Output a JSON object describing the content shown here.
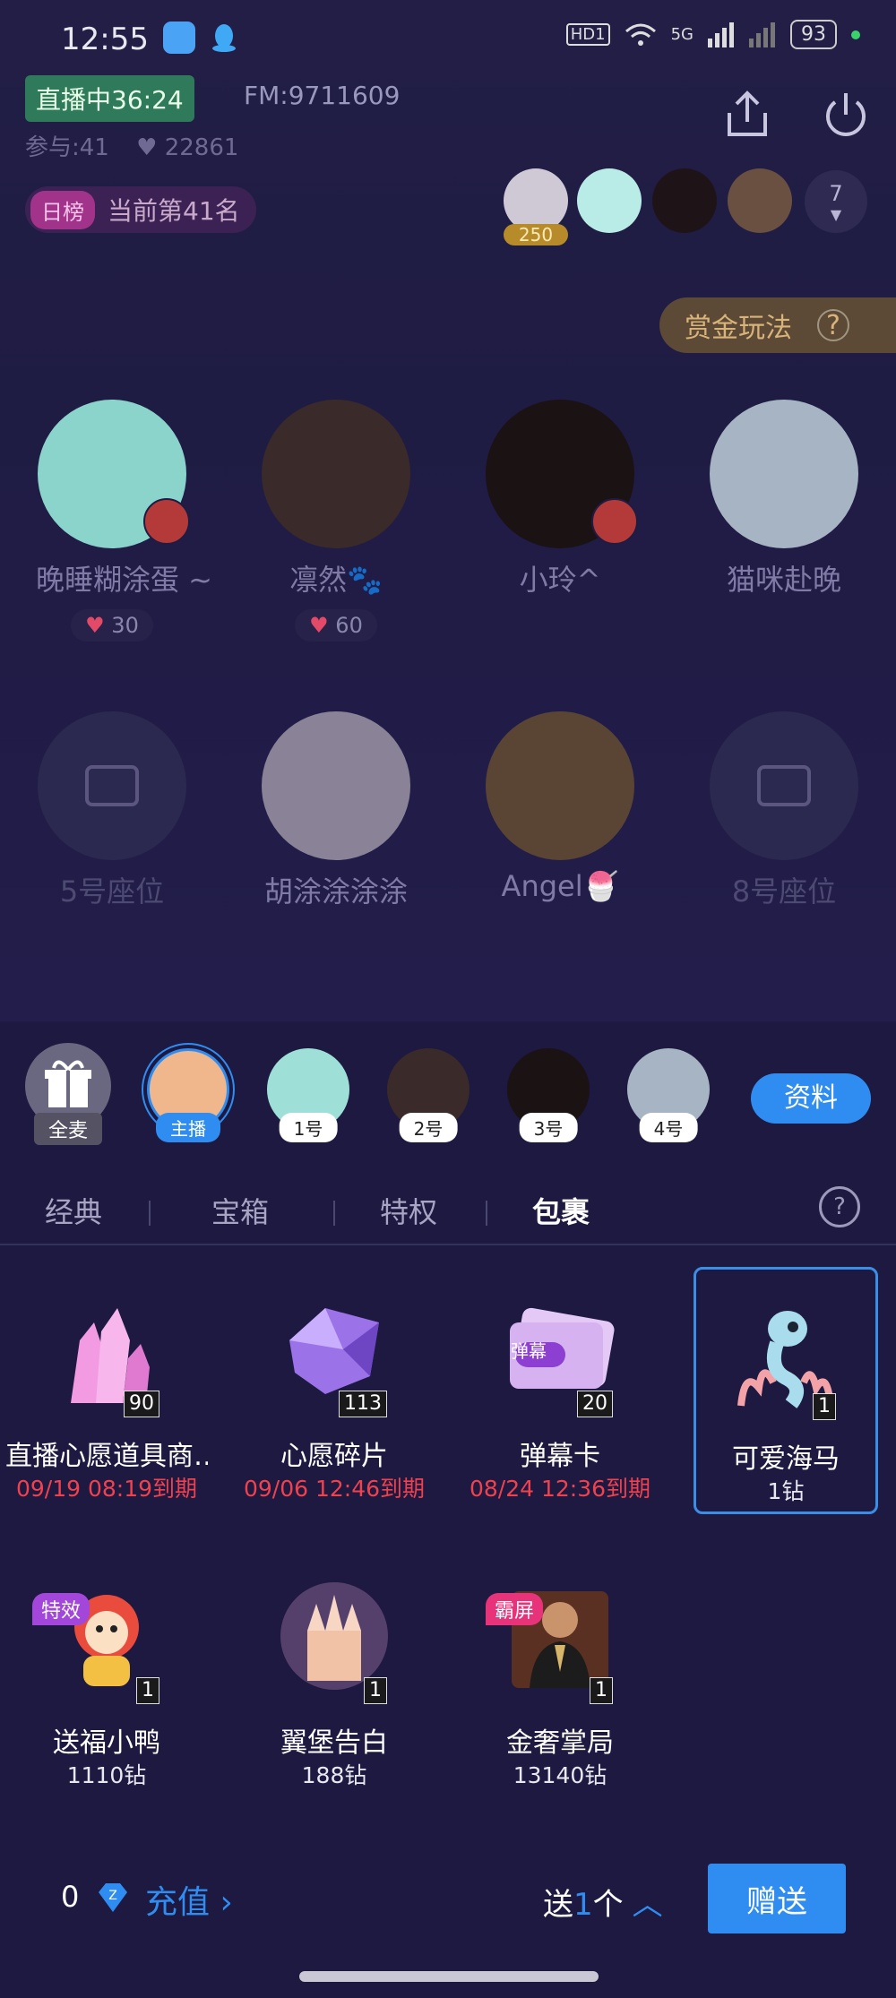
{
  "status_bar": {
    "time": "12:55",
    "battery": "93",
    "network": "5G",
    "hd": "HD1"
  },
  "room": {
    "live_badge": "直播中36:24",
    "fm_id": "FM:9711609",
    "participants": "参与:41",
    "likes": "22861",
    "rank_tag": "日榜",
    "rank_text": "当前第41名",
    "audience_first_badge": "250",
    "audience_more_count": "7",
    "bounty_label": "赏金玩法",
    "bounty_help": "?"
  },
  "seats": [
    {
      "name": "晚睡糊涂蛋 ~",
      "likes": "30",
      "muted": true
    },
    {
      "name": "凛然🐾",
      "likes": "60",
      "muted": false
    },
    {
      "name": "小玲^",
      "likes": "",
      "muted": true
    },
    {
      "name": "猫咪赴晚",
      "likes": "",
      "muted": false
    },
    {
      "name": "5号座位",
      "likes": "",
      "muted": false
    },
    {
      "name": "胡涂涂涂涂",
      "likes": "",
      "muted": false
    },
    {
      "name": "Angel🍧",
      "likes": "",
      "muted": false
    },
    {
      "name": "8号座位",
      "likes": "",
      "muted": false
    }
  ],
  "gift_panel": {
    "all_mic_label": "全麦",
    "targets": [
      "主播",
      "1号",
      "2号",
      "3号",
      "4号"
    ],
    "profile_button": "资料",
    "tabs": [
      "经典",
      "宝箱",
      "特权",
      "包裹"
    ],
    "active_tab": "包裹",
    "help": "?",
    "gifts": [
      {
        "name": "直播心愿道具商…",
        "count": "90",
        "sub": "09/19 08:19到期",
        "expiry": true
      },
      {
        "name": "心愿碎片",
        "count": "113",
        "sub": "09/06 12:46到期",
        "expiry": true
      },
      {
        "name": "弹幕卡",
        "count": "20",
        "sub": "08/24 12:36到期",
        "expiry": true,
        "card_text": "弹幕"
      },
      {
        "name": "可爱海马",
        "count": "1",
        "sub": "1钻",
        "expiry": false,
        "selected": true
      },
      {
        "name": "送福小鸭",
        "count": "1",
        "sub": "1110钻",
        "expiry": false,
        "badge": "特效"
      },
      {
        "name": "翼堡告白",
        "count": "1",
        "sub": "188钻",
        "expiry": false
      },
      {
        "name": "金奢掌局",
        "count": "1",
        "sub": "13140钻",
        "expiry": false,
        "badge": "霸屏"
      }
    ],
    "balance": "0",
    "recharge_label": "充值",
    "send_prefix": "送",
    "send_quantity": "1",
    "send_suffix": "个",
    "send_button": "赠送"
  },
  "colors": {
    "accent": "#2f8df1",
    "expiry": "#f0424e",
    "live": "#2f7a5a"
  }
}
